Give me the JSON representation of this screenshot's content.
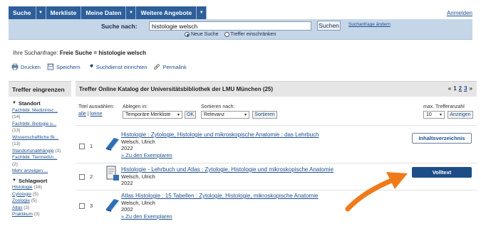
{
  "nav": {
    "items": [
      "Suche",
      "Merkliste",
      "Meine Daten",
      "Weitere Angebote"
    ],
    "login": "Anmelden"
  },
  "search": {
    "label": "Suche nach:",
    "value": "histologie welsch",
    "button": "Suchen",
    "change_link": "Suchanfrage ändern",
    "radio_new": "Neue Suche",
    "radio_refine": "Treffer einschränken",
    "selected_radio": "Neue Suche"
  },
  "query": {
    "prefix": "Ihre Suchanfrage:",
    "text": "Freie Suche = histologie welsch"
  },
  "toolbar": {
    "print": "Drucken",
    "save": "Speichern",
    "alert": "Suchdienst einrichten",
    "permalink": "Permalink"
  },
  "sidebar": {
    "heading": "Treffer eingrenzen",
    "facets": [
      {
        "title": "Standort",
        "entries": [
          {
            "label": "Fachbibl. Medizinisc...",
            "count": "(14)"
          },
          {
            "label": "Fachbibl. Biologie u...",
            "count": "(13)"
          },
          {
            "label": "Wissenschaftliche Bi...",
            "count": "(13)"
          },
          {
            "label": "Standortunabhängig",
            "count": "(3)"
          },
          {
            "label": "Fachbibl. Tiermedizi...",
            "count": "(2)"
          }
        ],
        "more": "Mehr anzeigen ..."
      },
      {
        "title": "Schlagwort",
        "entries": [
          {
            "label": "Histologie",
            "count": "(16)"
          },
          {
            "label": "Cytologie",
            "count": "(5)"
          },
          {
            "label": "Zoologie",
            "count": "(5)"
          },
          {
            "label": "Atlas",
            "count": "(3)"
          },
          {
            "label": "Praktikum",
            "count": "(3)"
          }
        ]
      }
    ]
  },
  "results": {
    "heading": "Treffer Online Katalog der Universitätsbibliothek der LMU München (25)",
    "pager": {
      "prev": "«",
      "pages": [
        "1",
        "2",
        "3"
      ],
      "next": "»"
    },
    "select_label": "Titel auswählen:",
    "select_all": "alle",
    "select_none": "keine",
    "store_label": "Ablegen in:",
    "store_value": "Temporäre Merkliste",
    "store_ok": "OK",
    "sort_label": "Sortieren nach:",
    "sort_value": "Relevanz",
    "sort_button": "Sortieren",
    "max_label": "max. Trefferanzahl",
    "max_value": "10",
    "max_button": "Anzeigen",
    "items": [
      {
        "num": "1",
        "title": "Histologie : Zytologie, Histologie und mikroskopische Anatomie : das Lehrbuch",
        "author": "Welsch, Ulrich",
        "year": "2022",
        "copies": "» Zu den Exemplaren",
        "action": "Inhaltsverzeichnis",
        "icon": "book-icon"
      },
      {
        "num": "2",
        "title": "Histologie - Lehrbuch und Atlas : Zytologie, Histologie und mikroskopische Anatomie",
        "author": "Welsch, Ulrich",
        "year": "2022",
        "copies": "",
        "action": "Volltext",
        "icon": "ebook-icon"
      },
      {
        "num": "3",
        "title": "Atlas Histologie : 15 Tabellen : Zytologie, Histologie, mikroskopische Anatomie",
        "author": "Welsch, Ulrich",
        "year": "2002",
        "copies": "» Zu den Exemplaren",
        "action": "",
        "icon": "book-icon"
      }
    ]
  },
  "colors": {
    "nav_bg": "#2d5f9a",
    "search_bg": "#c5d6e9",
    "primary_button": "#1c4d87",
    "annotation_arrow": "#f07a1a",
    "link": "#1c4f8c"
  }
}
